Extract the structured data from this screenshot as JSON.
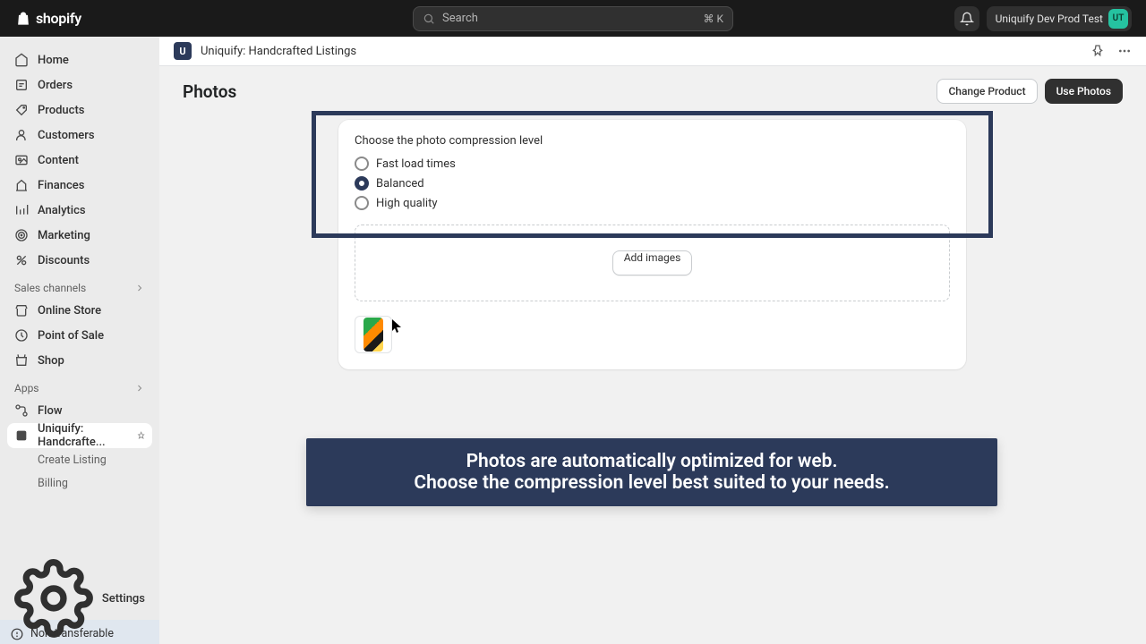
{
  "topbar": {
    "brand": "shopify",
    "search_placeholder": "Search",
    "search_shortcut": "⌘ K",
    "store_name": "Uniquify Dev Prod Test",
    "avatar_initials": "UT"
  },
  "sidebar": {
    "items": [
      {
        "label": "Home",
        "icon": "home-icon"
      },
      {
        "label": "Orders",
        "icon": "orders-icon"
      },
      {
        "label": "Products",
        "icon": "products-icon"
      },
      {
        "label": "Customers",
        "icon": "customers-icon"
      },
      {
        "label": "Content",
        "icon": "content-icon"
      },
      {
        "label": "Finances",
        "icon": "finances-icon"
      },
      {
        "label": "Analytics",
        "icon": "analytics-icon"
      },
      {
        "label": "Marketing",
        "icon": "marketing-icon"
      },
      {
        "label": "Discounts",
        "icon": "discounts-icon"
      }
    ],
    "section_channels": "Sales channels",
    "channels": [
      {
        "label": "Online Store",
        "icon": "online-store-icon"
      },
      {
        "label": "Point of Sale",
        "icon": "pos-icon"
      },
      {
        "label": "Shop",
        "icon": "shop-icon"
      }
    ],
    "section_apps": "Apps",
    "apps": [
      {
        "label": "Flow",
        "icon": "flow-icon"
      },
      {
        "label": "Uniquify: Handcrafte...",
        "icon": "uniquify-icon",
        "active": true
      }
    ],
    "app_sub": [
      {
        "label": "Create Listing"
      },
      {
        "label": "Billing"
      }
    ],
    "settings": "Settings",
    "non_transferable": "Non-transferable"
  },
  "appheader": {
    "app_name": "Uniquify: Handcrafted Listings",
    "app_badge": "U"
  },
  "page": {
    "title": "Photos",
    "change_product": "Change Product",
    "use_photos": "Use Photos"
  },
  "compression": {
    "heading": "Choose the photo compression level",
    "options": [
      {
        "label": "Fast load times",
        "selected": false
      },
      {
        "label": "Balanced",
        "selected": true
      },
      {
        "label": "High quality",
        "selected": false
      }
    ],
    "add_images": "Add images"
  },
  "banner": {
    "line1": "Photos are automatically optimized for web.",
    "line2": "Choose the compression level best suited to your needs."
  },
  "colors": {
    "accent_dark": "#2c3a5a",
    "topbar_bg": "#1a1a1a",
    "avatar_bg": "#25c2a0"
  }
}
